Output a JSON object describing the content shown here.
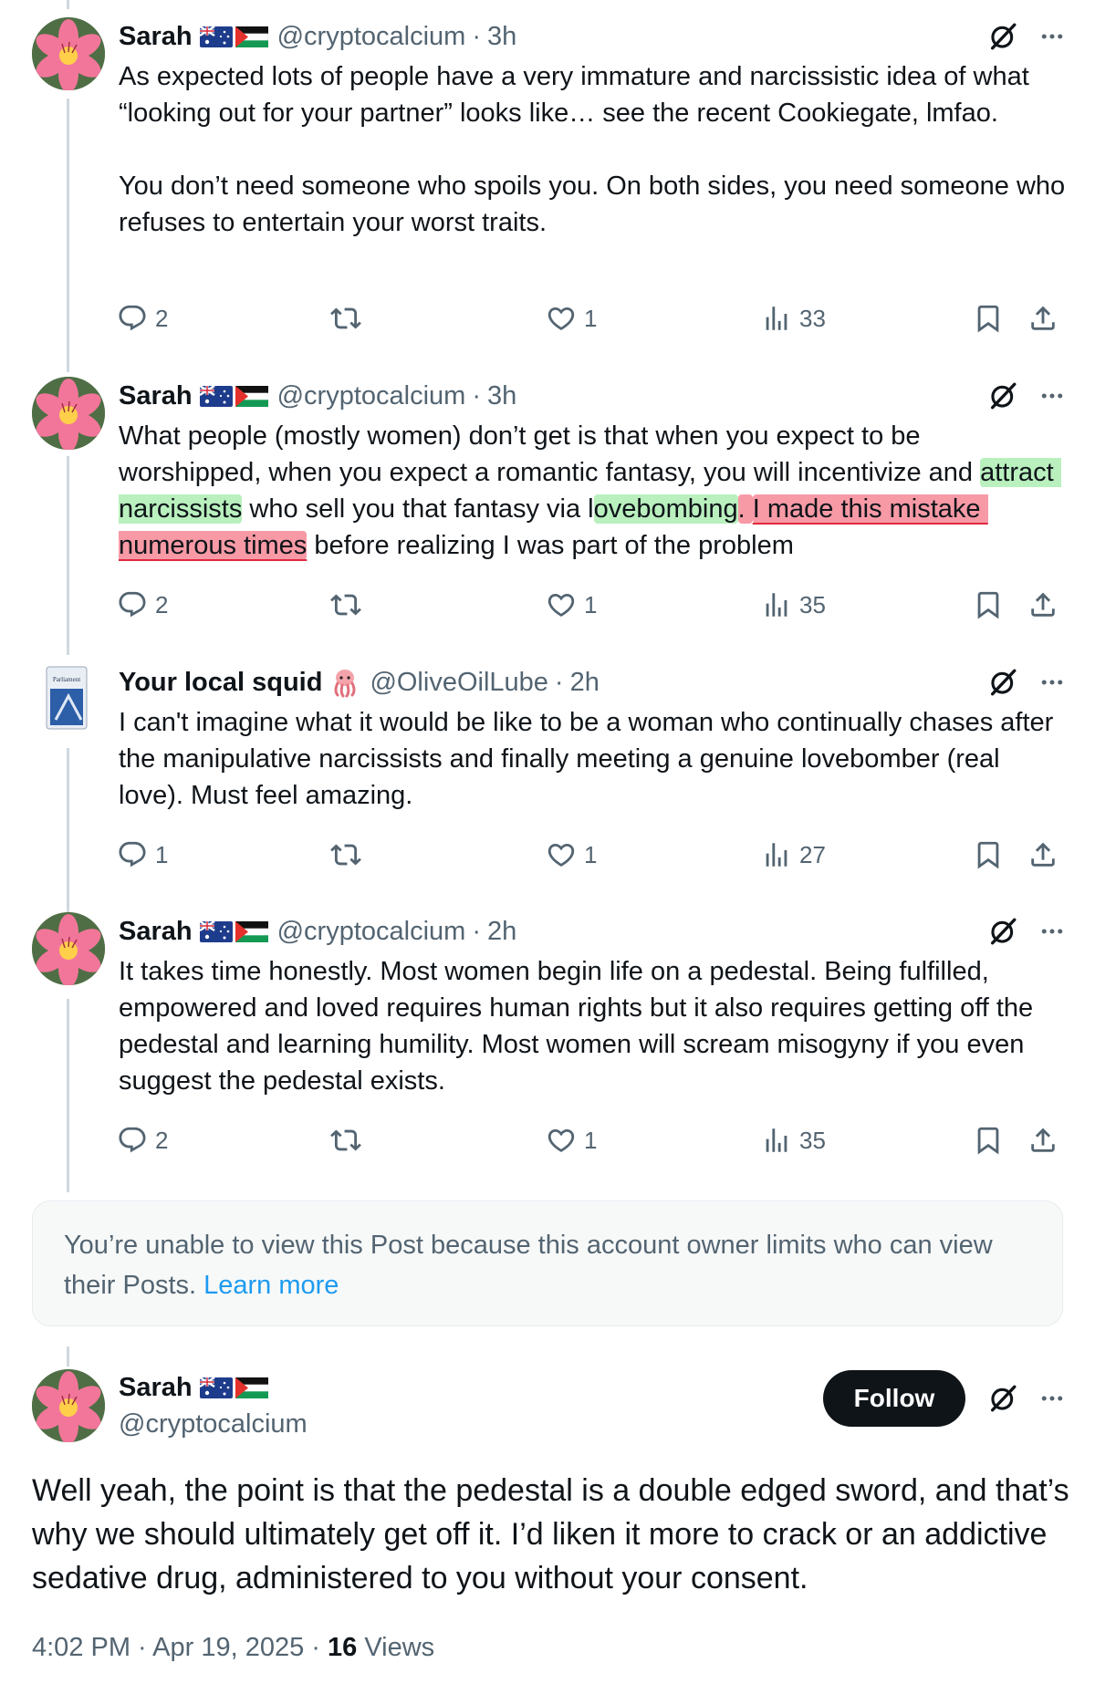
{
  "posts": [
    {
      "name": "Sarah",
      "handle": "@cryptocalcium",
      "time": "3h",
      "text": "As expected lots of people have a very immature and narcissistic idea of what “looking out for your partner” looks like… see the recent Cookiegate, lmfao.\n\nYou don’t need someone who spoils you. On both sides, you need someone who refuses to entertain your worst traits.",
      "replies": "2",
      "likes": "1",
      "views": "33"
    },
    {
      "name": "Sarah",
      "handle": "@cryptocalcium",
      "time": "3h",
      "text_parts": [
        "What people (mostly women) don’t get is that when you expect to be worshipped, when you expect a romantic fantasy, you will incentivize and ",
        "attract narcissists",
        " who sell you that fantasy via l",
        "ovebombing",
        ". ",
        "I made this mistake numerous times",
        " before realizing I was part of the problem"
      ],
      "replies": "2",
      "likes": "1",
      "views": "35"
    },
    {
      "name": "Your local squid",
      "handle": "@OliveOilLube",
      "time": "2h",
      "text": "I can't imagine what it would be like to be a woman who continually chases after the manipulative narcissists and finally meeting a genuine lovebomber (real love). Must feel amazing.",
      "replies": "1",
      "likes": "1",
      "views": "27"
    },
    {
      "name": "Sarah",
      "handle": "@cryptocalcium",
      "time": "2h",
      "text": "It takes time honestly. Most women begin life on a pedestal. Being fulfilled, empowered and loved requires human rights but it also requires getting off the pedestal and learning humility. Most women will scream misogyny if you even suggest the pedestal exists.",
      "replies": "2",
      "likes": "1",
      "views": "35"
    }
  ],
  "dot": "·",
  "restricted": {
    "text": "You’re unable to view this Post because this account owner limits who can view their Posts.",
    "link": "Learn more"
  },
  "main_post": {
    "name": "Sarah",
    "handle": "@cryptocalcium",
    "follow_label": "Follow",
    "text": "Well yeah, the point is that the pedestal is a double edged sword, and that’s why we should ultimately get off it. I’d liken it more to crack or an addictive sedative drug, administered to you without your consent.",
    "date": "4:02 PM · Apr 19, 2025 · ",
    "views_count": "16",
    "views_label": " Views"
  },
  "colors": {
    "text": "#0f1419",
    "secondary": "#536471",
    "link": "#1d9bf0",
    "highlight_green": "#b9f0be",
    "highlight_red": "#f79aa6"
  },
  "icons": [
    "reply-icon",
    "repost-icon",
    "like-icon",
    "views-icon",
    "bookmark-icon",
    "share-icon",
    "grok-icon",
    "more-icon"
  ]
}
